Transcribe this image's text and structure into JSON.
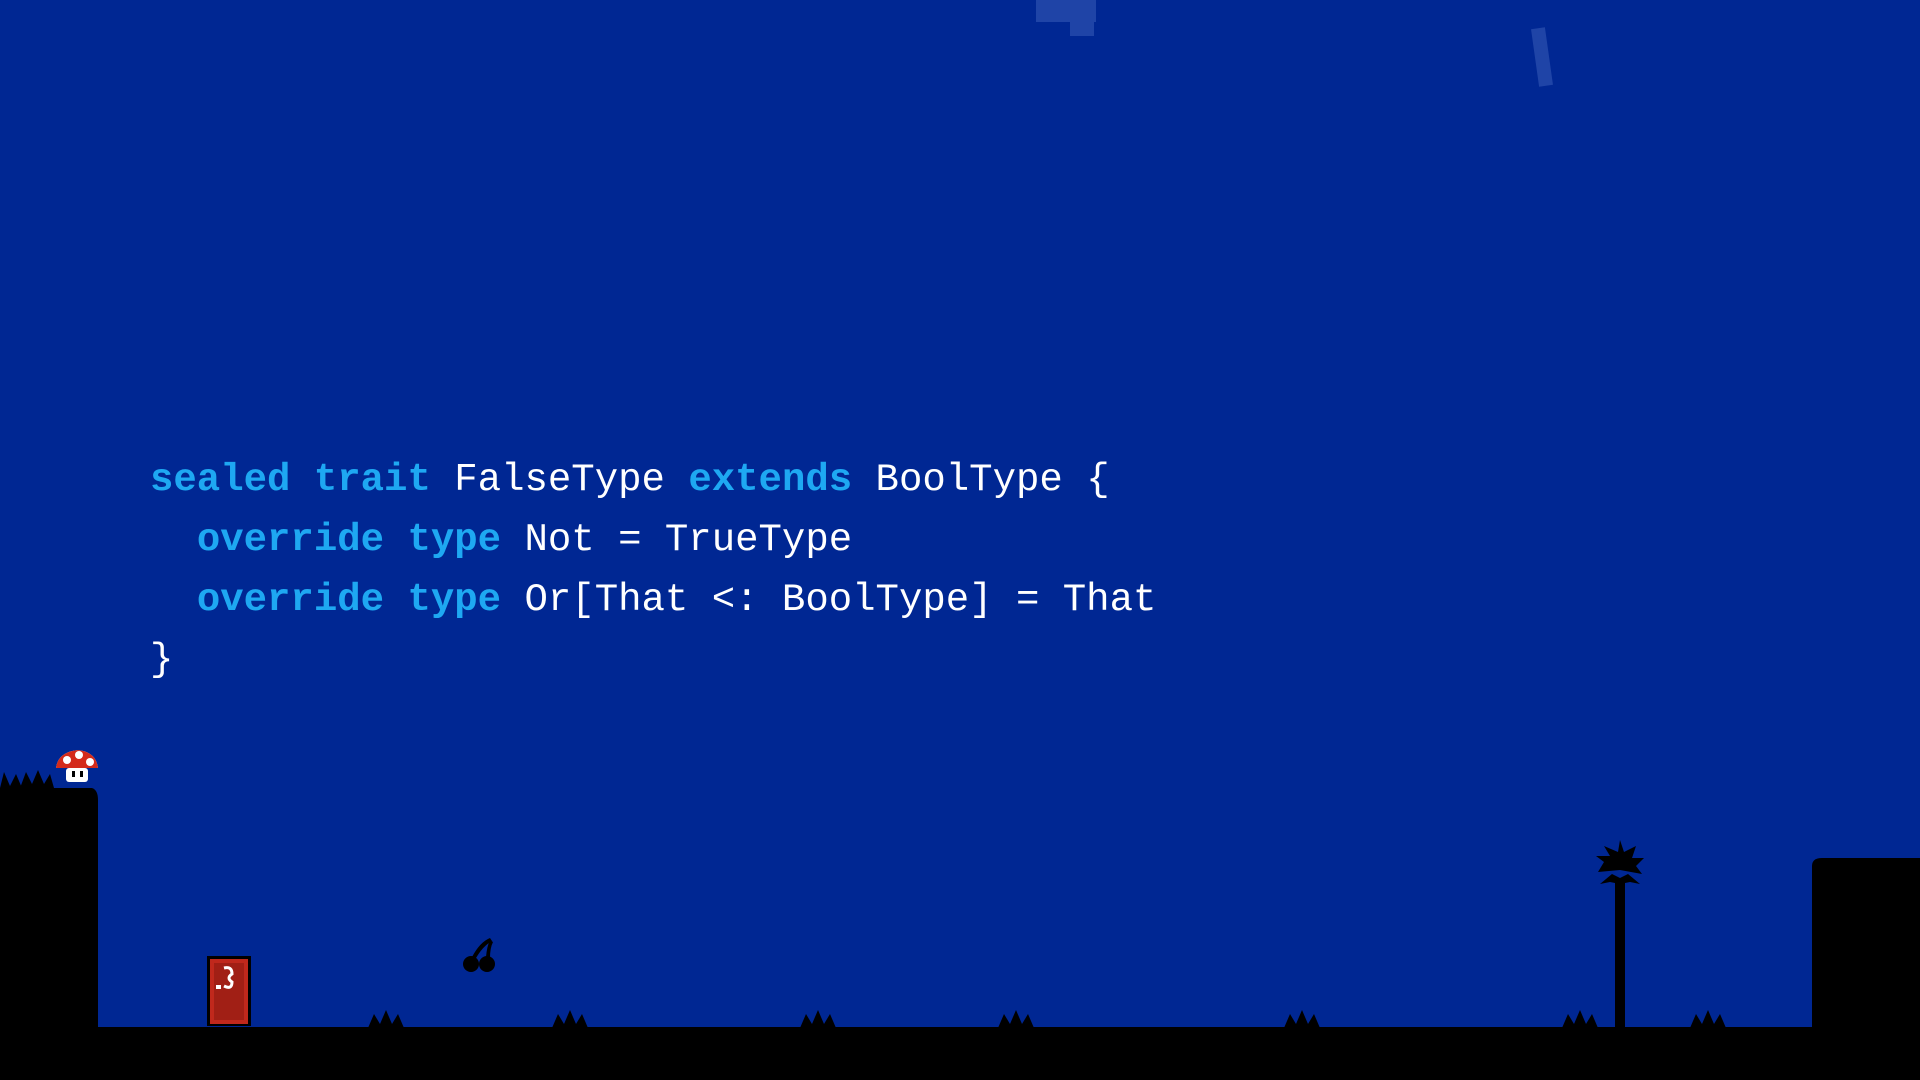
{
  "colors": {
    "background": "#002793",
    "keyword": "#1ea8f2",
    "text": "#ffffff",
    "silhouette": "#000000",
    "door": "#c0281c",
    "mushroom": "#d42a1a"
  },
  "code": {
    "lines": [
      [
        {
          "t": "sealed",
          "k": true
        },
        {
          "t": " ",
          "k": false
        },
        {
          "t": "trait",
          "k": true
        },
        {
          "t": " FalseType ",
          "k": false
        },
        {
          "t": "extends",
          "k": true
        },
        {
          "t": " BoolType {",
          "k": false
        }
      ],
      [
        {
          "t": "  ",
          "k": false
        },
        {
          "t": "override",
          "k": true
        },
        {
          "t": " ",
          "k": false
        },
        {
          "t": "type",
          "k": true
        },
        {
          "t": " Not = TrueType",
          "k": false
        }
      ],
      [
        {
          "t": "  ",
          "k": false
        },
        {
          "t": "override",
          "k": true
        },
        {
          "t": " ",
          "k": false
        },
        {
          "t": "type",
          "k": true
        },
        {
          "t": " Or[That <: BoolType] = That",
          "k": false
        }
      ],
      [
        {
          "t": "}",
          "k": false
        }
      ]
    ]
  },
  "scenery": {
    "icons": [
      "mushroom-icon",
      "door-icon",
      "cherry-icon",
      "palm-tree-icon",
      "grass-tuft-icon"
    ]
  }
}
